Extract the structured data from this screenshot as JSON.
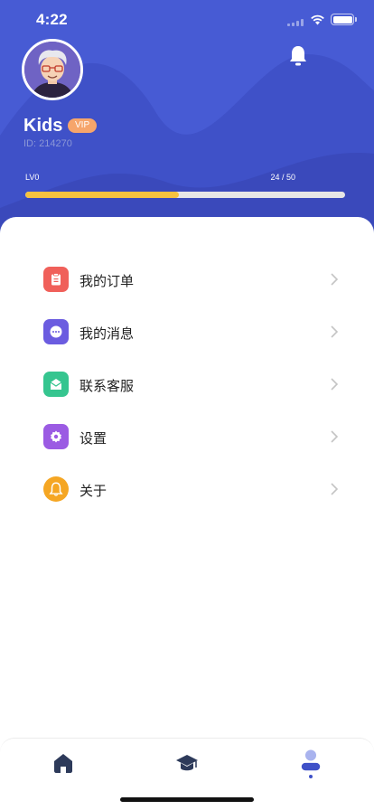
{
  "status_bar": {
    "time": "4:22"
  },
  "profile": {
    "username": "Kids",
    "badge": "VIP",
    "user_id": "ID: 214270",
    "level_label": "LV0",
    "level_progress_text": "24 / 50",
    "level_progress_fraction": 0.48
  },
  "menu": {
    "items": [
      {
        "label": "我的订单",
        "icon": "clipboard-icon",
        "color": "#f0605a"
      },
      {
        "label": "我的消息",
        "icon": "message-icon",
        "color": "#6b5ce0"
      },
      {
        "label": "联系客服",
        "icon": "mail-icon",
        "color": "#35c58f"
      },
      {
        "label": "设置",
        "icon": "gear-icon",
        "color": "#9b5be3"
      },
      {
        "label": "关于",
        "icon": "bell-icon",
        "color": "#f5a623"
      }
    ]
  },
  "tabbar": {
    "tabs": [
      {
        "icon": "home-icon",
        "active": false
      },
      {
        "icon": "graduation-cap-icon",
        "active": false
      },
      {
        "icon": "profile-icon",
        "active": true
      }
    ]
  },
  "colors": {
    "header": "#3f51c8",
    "progress_fill": "#f7c23f",
    "vip_badge": "#f6a56b",
    "active_tab": "#3f51c8"
  }
}
